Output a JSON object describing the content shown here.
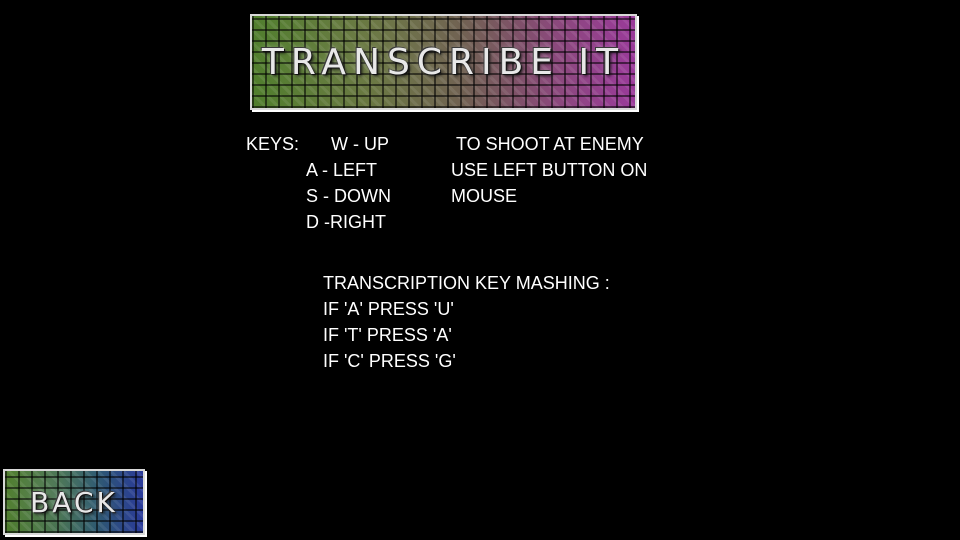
{
  "title_banner": {
    "text": "TRANSCRIBE IT"
  },
  "controls": {
    "heading": "KEYS:",
    "keys": [
      "W - UP",
      "A - LEFT",
      "S - DOWN",
      "D -RIGHT"
    ],
    "shoot_instructions": [
      "TO SHOOT AT ENEMY",
      "USE LEFT BUTTON ON",
      "MOUSE"
    ]
  },
  "key_mashing": {
    "heading": "TRANSCRIPTION KEY MASHING :",
    "rules": [
      "IF 'A' PRESS 'U'",
      "IF 'T' PRESS 'A'",
      "IF 'C' PRESS 'G'"
    ]
  },
  "back_button": {
    "label": "BACK"
  },
  "colors": {
    "background": "#000000",
    "text": "#ffffff",
    "tile_green": "#4a7a26",
    "tile_purple": "#9a3a9a",
    "tile_blue": "#2a3a9a"
  }
}
